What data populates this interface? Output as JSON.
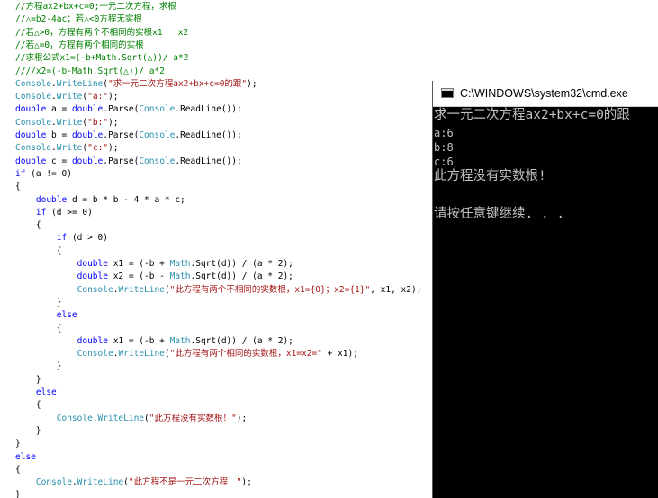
{
  "editor": {
    "lines": [
      [
        {
          "t": "//方程ax2+bx+c=0;一元二次方程，求根",
          "k": "comment"
        }
      ],
      [
        {
          "t": "//△=b2-4ac；若△<0方程无实根",
          "k": "comment"
        }
      ],
      [
        {
          "t": "//若△>0，方程有两个不相同的实根x1   x2",
          "k": "comment"
        }
      ],
      [
        {
          "t": "//若△=0，方程有两个相同的实根",
          "k": "comment"
        }
      ],
      [
        {
          "t": "//求根公式x1=(-b+Math.Sqrt(△))/ a*2",
          "k": "comment"
        }
      ],
      [
        {
          "t": "////x2=(-b-Math.Sqrt(△))/ a*2",
          "k": "comment"
        }
      ],
      [
        {
          "t": "Console",
          "k": "type"
        },
        {
          "t": ".",
          "k": "plain"
        },
        {
          "t": "WriteLine",
          "k": "type"
        },
        {
          "t": "(",
          "k": "plain"
        },
        {
          "t": "\"求一元二次方程ax2+bx+c=0的跟\"",
          "k": "str"
        },
        {
          "t": ");",
          "k": "plain"
        }
      ],
      [
        {
          "t": "Console",
          "k": "type"
        },
        {
          "t": ".",
          "k": "plain"
        },
        {
          "t": "Write",
          "k": "type"
        },
        {
          "t": "(",
          "k": "plain"
        },
        {
          "t": "\"a:\"",
          "k": "str"
        },
        {
          "t": ");",
          "k": "plain"
        }
      ],
      [
        {
          "t": "double",
          "k": "kw"
        },
        {
          "t": " a = ",
          "k": "plain"
        },
        {
          "t": "double",
          "k": "kw"
        },
        {
          "t": ".Parse(",
          "k": "plain"
        },
        {
          "t": "Console",
          "k": "type"
        },
        {
          "t": ".ReadLine());",
          "k": "plain"
        }
      ],
      [
        {
          "t": "Console",
          "k": "type"
        },
        {
          "t": ".",
          "k": "plain"
        },
        {
          "t": "Write",
          "k": "type"
        },
        {
          "t": "(",
          "k": "plain"
        },
        {
          "t": "\"b:\"",
          "k": "str"
        },
        {
          "t": ");",
          "k": "plain"
        }
      ],
      [
        {
          "t": "double",
          "k": "kw"
        },
        {
          "t": " b = ",
          "k": "plain"
        },
        {
          "t": "double",
          "k": "kw"
        },
        {
          "t": ".Parse(",
          "k": "plain"
        },
        {
          "t": "Console",
          "k": "type"
        },
        {
          "t": ".ReadLine());",
          "k": "plain"
        }
      ],
      [
        {
          "t": "Console",
          "k": "type"
        },
        {
          "t": ".",
          "k": "plain"
        },
        {
          "t": "Write",
          "k": "type"
        },
        {
          "t": "(",
          "k": "plain"
        },
        {
          "t": "\"c:\"",
          "k": "str"
        },
        {
          "t": ");",
          "k": "plain"
        }
      ],
      [
        {
          "t": "double",
          "k": "kw"
        },
        {
          "t": " c = ",
          "k": "plain"
        },
        {
          "t": "double",
          "k": "kw"
        },
        {
          "t": ".Parse(",
          "k": "plain"
        },
        {
          "t": "Console",
          "k": "type"
        },
        {
          "t": ".ReadLine());",
          "k": "plain"
        }
      ],
      [
        {
          "t": "if",
          "k": "kw"
        },
        {
          "t": " (a != 0)",
          "k": "plain"
        }
      ],
      [
        {
          "t": "{",
          "k": "plain"
        }
      ],
      [
        {
          "t": "    ",
          "k": "plain"
        },
        {
          "t": "double",
          "k": "kw"
        },
        {
          "t": " d = b * b - 4 * a * c;",
          "k": "plain"
        }
      ],
      [
        {
          "t": "    ",
          "k": "plain"
        },
        {
          "t": "if",
          "k": "kw"
        },
        {
          "t": " (d >= 0)",
          "k": "plain"
        }
      ],
      [
        {
          "t": "    {",
          "k": "plain"
        }
      ],
      [
        {
          "t": "        ",
          "k": "plain"
        },
        {
          "t": "if",
          "k": "kw"
        },
        {
          "t": " (d > 0)",
          "k": "plain"
        }
      ],
      [
        {
          "t": "        {",
          "k": "plain"
        }
      ],
      [
        {
          "t": "            ",
          "k": "plain"
        },
        {
          "t": "double",
          "k": "kw"
        },
        {
          "t": " x1 = (-b + ",
          "k": "plain"
        },
        {
          "t": "Math",
          "k": "type"
        },
        {
          "t": ".Sqrt(d)) / (a * 2);",
          "k": "plain"
        }
      ],
      [
        {
          "t": "            ",
          "k": "plain"
        },
        {
          "t": "double",
          "k": "kw"
        },
        {
          "t": " x2 = (-b - ",
          "k": "plain"
        },
        {
          "t": "Math",
          "k": "type"
        },
        {
          "t": ".Sqrt(d)) / (a * 2);",
          "k": "plain"
        }
      ],
      [
        {
          "t": "            ",
          "k": "plain"
        },
        {
          "t": "Console",
          "k": "type"
        },
        {
          "t": ".",
          "k": "plain"
        },
        {
          "t": "WriteLine",
          "k": "type"
        },
        {
          "t": "(",
          "k": "plain"
        },
        {
          "t": "\"此方程有两个不相同的实数根，x1={0}；x2={1}\"",
          "k": "str"
        },
        {
          "t": ", x1, x2);",
          "k": "plain"
        }
      ],
      [
        {
          "t": "        }",
          "k": "plain"
        }
      ],
      [
        {
          "t": "        ",
          "k": "plain"
        },
        {
          "t": "else",
          "k": "kw"
        }
      ],
      [
        {
          "t": "        {",
          "k": "plain"
        }
      ],
      [
        {
          "t": "            ",
          "k": "plain"
        },
        {
          "t": "double",
          "k": "kw"
        },
        {
          "t": " x1 = (-b + ",
          "k": "plain"
        },
        {
          "t": "Math",
          "k": "type"
        },
        {
          "t": ".Sqrt(d)) / (a * 2);",
          "k": "plain"
        }
      ],
      [
        {
          "t": "            ",
          "k": "plain"
        },
        {
          "t": "Console",
          "k": "type"
        },
        {
          "t": ".",
          "k": "plain"
        },
        {
          "t": "WriteLine",
          "k": "type"
        },
        {
          "t": "(",
          "k": "plain"
        },
        {
          "t": "\"此方程有两个相同的实数根，x1=x2=\"",
          "k": "str"
        },
        {
          "t": " + x1);",
          "k": "plain"
        }
      ],
      [
        {
          "t": "        }",
          "k": "plain"
        }
      ],
      [
        {
          "t": "    }",
          "k": "plain"
        }
      ],
      [
        {
          "t": "    ",
          "k": "plain"
        },
        {
          "t": "else",
          "k": "kw"
        }
      ],
      [
        {
          "t": "    {",
          "k": "plain"
        }
      ],
      [
        {
          "t": "        ",
          "k": "plain"
        },
        {
          "t": "Console",
          "k": "type"
        },
        {
          "t": ".",
          "k": "plain"
        },
        {
          "t": "WriteLine",
          "k": "type"
        },
        {
          "t": "(",
          "k": "plain"
        },
        {
          "t": "\"此方程没有实数根！\"",
          "k": "str"
        },
        {
          "t": ");",
          "k": "plain"
        }
      ],
      [
        {
          "t": "    }",
          "k": "plain"
        }
      ],
      [
        {
          "t": "}",
          "k": "plain"
        }
      ],
      [
        {
          "t": "else",
          "k": "kw"
        }
      ],
      [
        {
          "t": "{",
          "k": "plain"
        }
      ],
      [
        {
          "t": "    ",
          "k": "plain"
        },
        {
          "t": "Console",
          "k": "type"
        },
        {
          "t": ".",
          "k": "plain"
        },
        {
          "t": "WriteLine",
          "k": "type"
        },
        {
          "t": "(",
          "k": "plain"
        },
        {
          "t": "\"此方程不是一元二次方程！\"",
          "k": "str"
        },
        {
          "t": ");",
          "k": "plain"
        }
      ],
      [
        {
          "t": "}",
          "k": "plain"
        }
      ]
    ]
  },
  "cmd": {
    "title": "C:\\WINDOWS\\system32\\cmd.exe",
    "icon": "cmd-icon",
    "lines": [
      {
        "text": "求一元二次方程ax2+bx+c=0的跟",
        "size": "big"
      },
      {
        "text": "a:6",
        "size": "small"
      },
      {
        "text": "b:8",
        "size": "small"
      },
      {
        "text": "c:6",
        "size": "small"
      },
      {
        "text": "此方程没有实数根!",
        "size": "big"
      },
      {
        "text": "",
        "size": "small"
      },
      {
        "text": "请按任意键继续. . .",
        "size": "big"
      }
    ]
  },
  "colors": {
    "comment": "#008000",
    "keyword": "#0000ff",
    "type": "#2b91af",
    "string": "#a31515",
    "console_bg": "#000000",
    "console_fg": "#c0c0c0"
  }
}
